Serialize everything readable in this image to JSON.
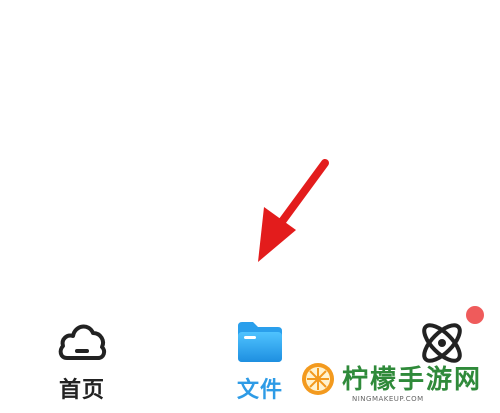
{
  "colors": {
    "background": "#ffffff",
    "active_tab": "#2e9be6",
    "inactive_tab": "#222222",
    "annotation_arrow": "#e31c1c",
    "badge": "#ef5b5b",
    "watermark_green": "#2f8a3a",
    "watermark_orange": "#f39a1e"
  },
  "tab_bar": {
    "active_tab": "files",
    "tabs": [
      {
        "id": "home",
        "label": "首页",
        "icon": "cloud-home-icon",
        "active": false
      },
      {
        "id": "files",
        "label": "文件",
        "icon": "folder-icon",
        "active": true
      },
      {
        "id": "discover",
        "label": "",
        "icon": "atom-icon",
        "active": false,
        "badge": true
      }
    ]
  },
  "annotation": {
    "type": "arrow",
    "points_to": "files-tab",
    "icon": "red-arrow"
  },
  "watermark": {
    "title": "柠檬手游网",
    "url": "NINGMAKEUP.COM",
    "icon": "lemon-slice-icon"
  }
}
